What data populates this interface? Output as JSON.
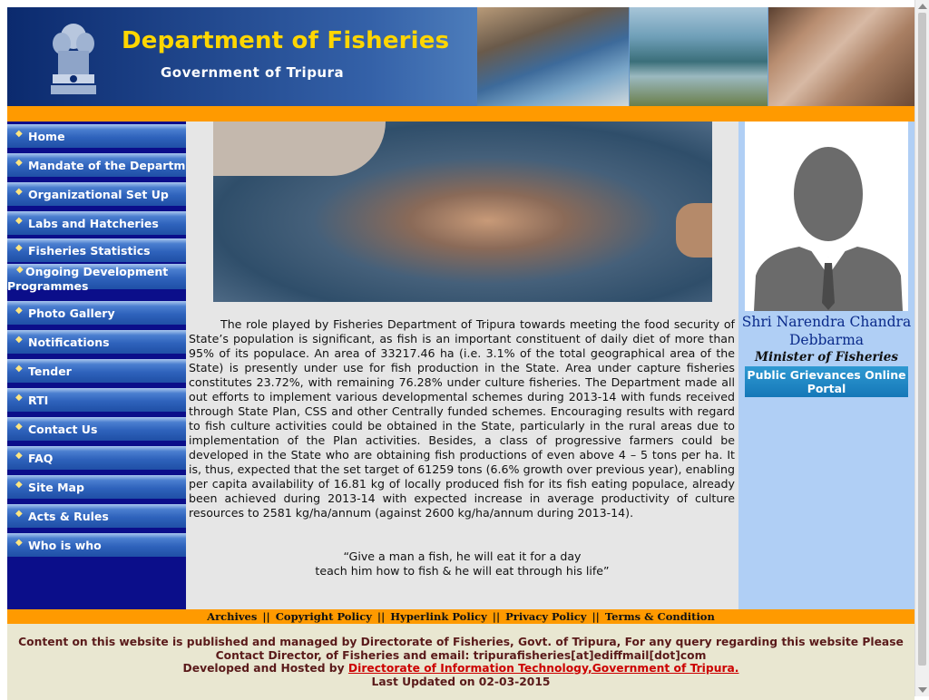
{
  "header": {
    "title": "Department of Fisheries",
    "subtitle": "Government of Tripura"
  },
  "nav": {
    "items": [
      {
        "label": "Home"
      },
      {
        "label": "Mandate of the Department"
      },
      {
        "label": "Organizational Set Up"
      },
      {
        "label": "Labs and Hatcheries"
      },
      {
        "label": "Fisheries Statistics"
      },
      {
        "label": "Ongoing Development Programmes"
      },
      {
        "label": "Photo Gallery"
      },
      {
        "label": "Notifications"
      },
      {
        "label": "Tender"
      },
      {
        "label": "RTI"
      },
      {
        "label": "Contact Us"
      },
      {
        "label": "FAQ"
      },
      {
        "label": "Site Map"
      },
      {
        "label": "Acts & Rules"
      },
      {
        "label": "Who is who"
      }
    ]
  },
  "main": {
    "intro": "The role played by Fisheries Department of Tripura towards meeting the food security of State’s population is significant, as fish is an important constituent of daily diet of more than 95% of its populace. An area of 33217.46 ha (i.e. 3.1% of the total geographical area of the State) is presently under use for fish production in the State. Area under capture fisheries constitutes 23.72%, with remaining 76.28% under culture fisheries. The Department made all out efforts to implement various developmental schemes during 2013-14 with funds received through State Plan, CSS and other Centrally funded schemes. Encouraging results with regard to fish culture activities could be obtained in the State, particularly in the rural areas due to implementation of the Plan activities. Besides, a class of progressive farmers could be developed in the State who are obtaining fish productions of even above 4 – 5 tons per ha. It is, thus, expected that the set target of 61259 tons (6.6% growth over previous year), enabling per capita availability of 16.81 kg of locally produced fish for its fish eating populace, already been achieved during 2013-14 with expected increase in average productivity of culture resources to 2581 kg/ha/annum (against 2600 kg/ha/annum during 2013-14).",
    "quote_line1": "“Give a man a fish, he will eat it for a day",
    "quote_line2": "teach him how to fish & he will eat through his life”"
  },
  "minister": {
    "name": "Shri Narendra Chandra Debbarma",
    "title": "Minister of Fisheries",
    "grievance_button": "Public Grievances Online Portal"
  },
  "footer_links": {
    "archives": "Archives",
    "copyright": "Copyright Policy",
    "hyperlink": "Hyperlink Policy",
    "privacy": "Privacy Policy",
    "terms": "Terms & Condition",
    "separator": "||"
  },
  "footer": {
    "line1": "Content on this website is published and managed by Directorate of Fisheries, Govt. of Tripura, For any query regarding this website Please Contact Director, of Fisheries and email: tripurafisheries[at]ediffmail[dot]com",
    "developed_prefix": "Developed and Hosted by",
    "developed_link": "Directorate of Information Technology,Government of Tripura.",
    "last_updated": "Last Updated on 02-03-2015"
  },
  "colors": {
    "accent_orange": "#ff9a00",
    "sidebar_navy": "#0b0e8a",
    "title_yellow": "#ffd600",
    "right_panel": "#b0cff5",
    "footer_link_red": "#cc0000"
  },
  "icons": {
    "nav_bullet": "diamond-icon",
    "emblem": "state-emblem-icon",
    "avatar": "person-silhouette-icon"
  }
}
